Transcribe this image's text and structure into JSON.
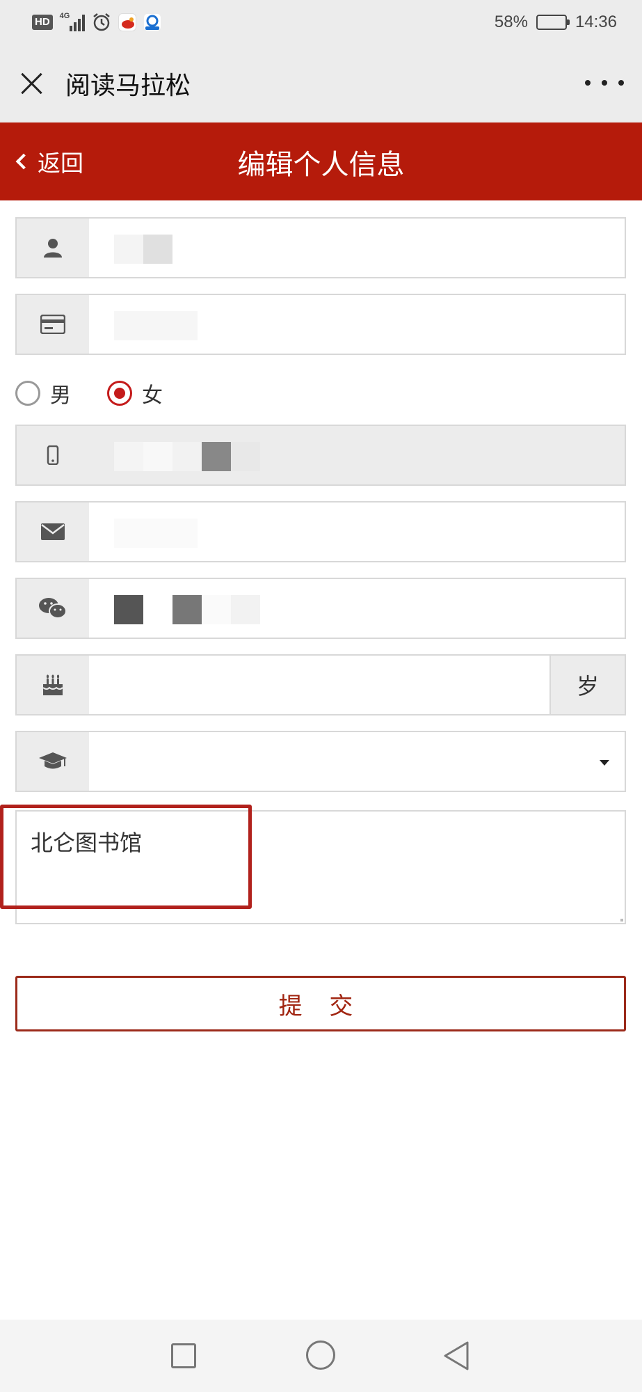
{
  "status_bar": {
    "network_badge": "HD",
    "network_type": "4G",
    "battery_percent": "58%",
    "battery_level": 0.58,
    "time": "14:36",
    "icons": [
      "hd-icon",
      "signal-icon",
      "alarm-icon",
      "sina-icon",
      "app-icon"
    ]
  },
  "wechat_bar": {
    "title": "阅读马拉松",
    "close_icon": "close-icon",
    "more_icon": "more-icon"
  },
  "header": {
    "back_label": "返回",
    "title": "编辑个人信息",
    "bg_color": "#b51b0b"
  },
  "form": {
    "name": {
      "icon": "user-icon"
    },
    "id_card": {
      "icon": "id-card-icon"
    },
    "gender": {
      "male_label": "男",
      "female_label": "女",
      "selected": "女"
    },
    "phone": {
      "icon": "phone-icon"
    },
    "email": {
      "icon": "email-icon"
    },
    "wechat": {
      "icon": "wechat-icon"
    },
    "age": {
      "icon": "cake-icon",
      "unit": "岁"
    },
    "education": {
      "icon": "graduation-cap-icon"
    },
    "note": {
      "value": "北仑图书馆"
    }
  },
  "submit_label": "提 交",
  "accent_color": "#b1211c",
  "nav": {
    "icons": [
      "recent-apps-icon",
      "home-icon",
      "back-icon"
    ]
  }
}
